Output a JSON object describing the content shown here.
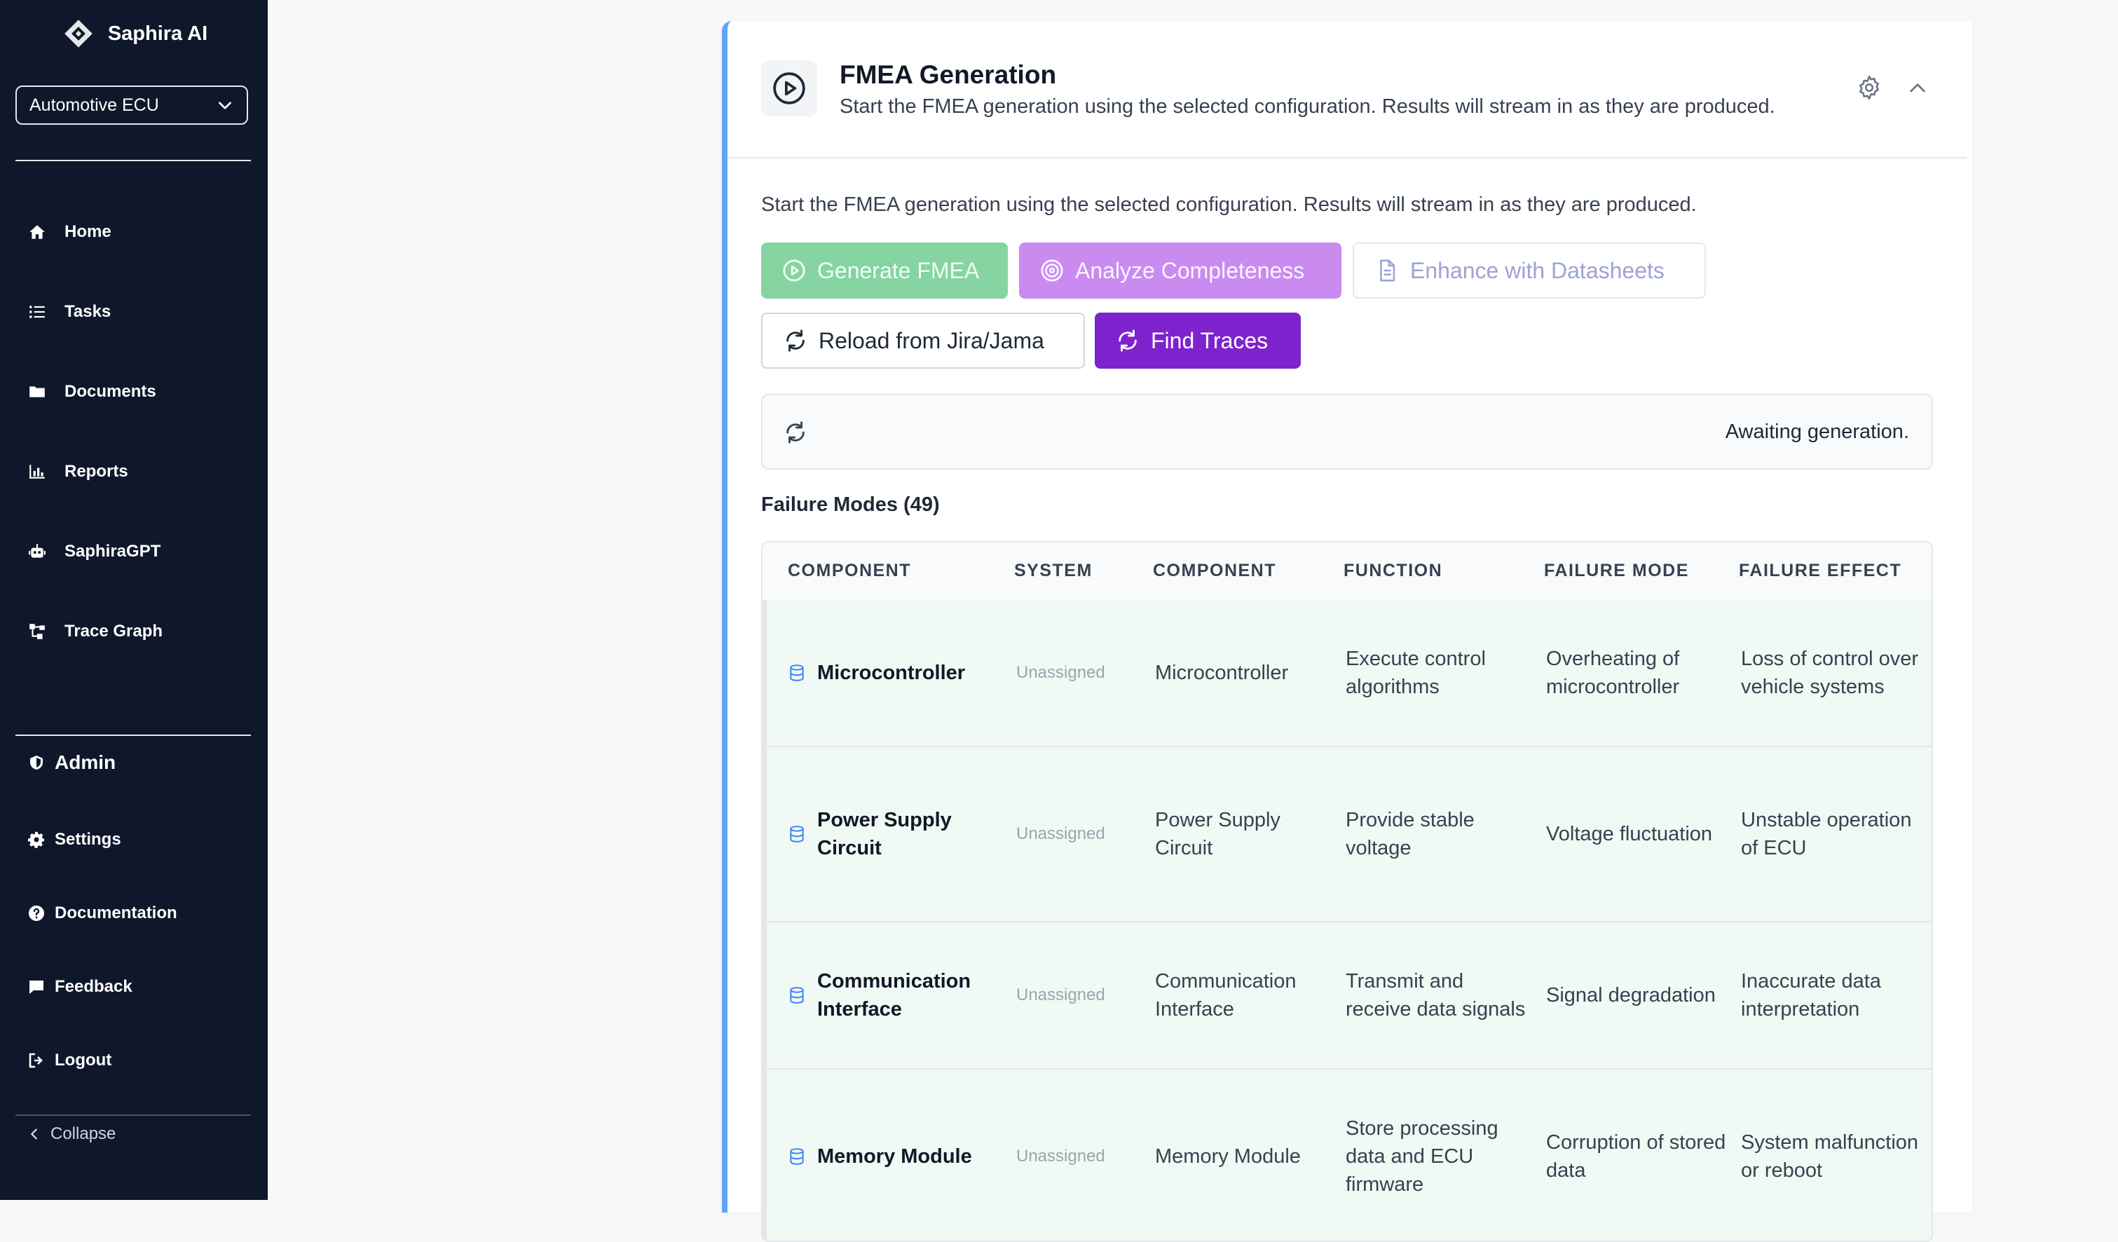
{
  "app": {
    "name": "Saphira AI"
  },
  "project_selector": {
    "value": "Automotive ECU"
  },
  "nav": [
    {
      "label": "Home",
      "icon": "home-icon"
    },
    {
      "label": "Tasks",
      "icon": "list-icon"
    },
    {
      "label": "Documents",
      "icon": "folder-icon"
    },
    {
      "label": "Reports",
      "icon": "bar-chart-icon"
    },
    {
      "label": "SaphiraGPT",
      "icon": "robot-icon"
    },
    {
      "label": "Trace Graph",
      "icon": "graph-icon"
    }
  ],
  "admin": {
    "heading": "Admin",
    "items": [
      {
        "label": "Settings",
        "icon": "gear-icon"
      },
      {
        "label": "Documentation",
        "icon": "help-icon"
      },
      {
        "label": "Feedback",
        "icon": "chat-icon"
      },
      {
        "label": "Logout",
        "icon": "logout-icon"
      }
    ]
  },
  "collapse_label": "Collapse",
  "panel": {
    "title": "FMEA Generation",
    "subtitle": "Start the FMEA generation using the selected configuration. Results will stream in as they are produced.",
    "description": "Start the FMEA generation using the selected configuration. Results will stream in as they are produced.",
    "buttons": {
      "generate": "Generate FMEA",
      "analyze": "Analyze Completeness",
      "enhance": "Enhance with Datasheets",
      "reload": "Reload from Jira/Jama",
      "traces": "Find Traces"
    },
    "status": "Awaiting generation.",
    "section_title": "Failure Modes (49)"
  },
  "table": {
    "headers": [
      "COMPONENT",
      "SYSTEM",
      "COMPONENT",
      "FUNCTION",
      "FAILURE MODE",
      "FAILURE EFFECT"
    ],
    "rows": [
      {
        "component": "Microcontroller",
        "system": "Unassigned",
        "component2": "Microcontroller",
        "function": "Execute control algorithms",
        "failure_mode": "Overheating of microcontroller",
        "failure_effect": "Loss of control over vehicle systems"
      },
      {
        "component": "Power Supply Circuit",
        "system": "Unassigned",
        "component2": "Power Supply Circuit",
        "function": "Provide stable voltage",
        "failure_mode": "Voltage fluctuation",
        "failure_effect": "Unstable operation of ECU"
      },
      {
        "component": "Communication Interface",
        "system": "Unassigned",
        "component2": "Communication Interface",
        "function": "Transmit and receive data signals",
        "failure_mode": "Signal degradation",
        "failure_effect": "Inaccurate data interpretation"
      },
      {
        "component": "Memory Module",
        "system": "Unassigned",
        "component2": "Memory Module",
        "function": "Store processing data and ECU firmware",
        "failure_mode": "Corruption of stored data",
        "failure_effect": "System malfunction or reboot"
      }
    ]
  },
  "colors": {
    "sidebar_bg": "#0f172a",
    "accent_blue": "#60a5fa",
    "generate_green": "#86d4a2",
    "analyze_purple": "#c98bf0",
    "traces_purple": "#7e22ce",
    "row_bg": "#f0f9f3"
  }
}
